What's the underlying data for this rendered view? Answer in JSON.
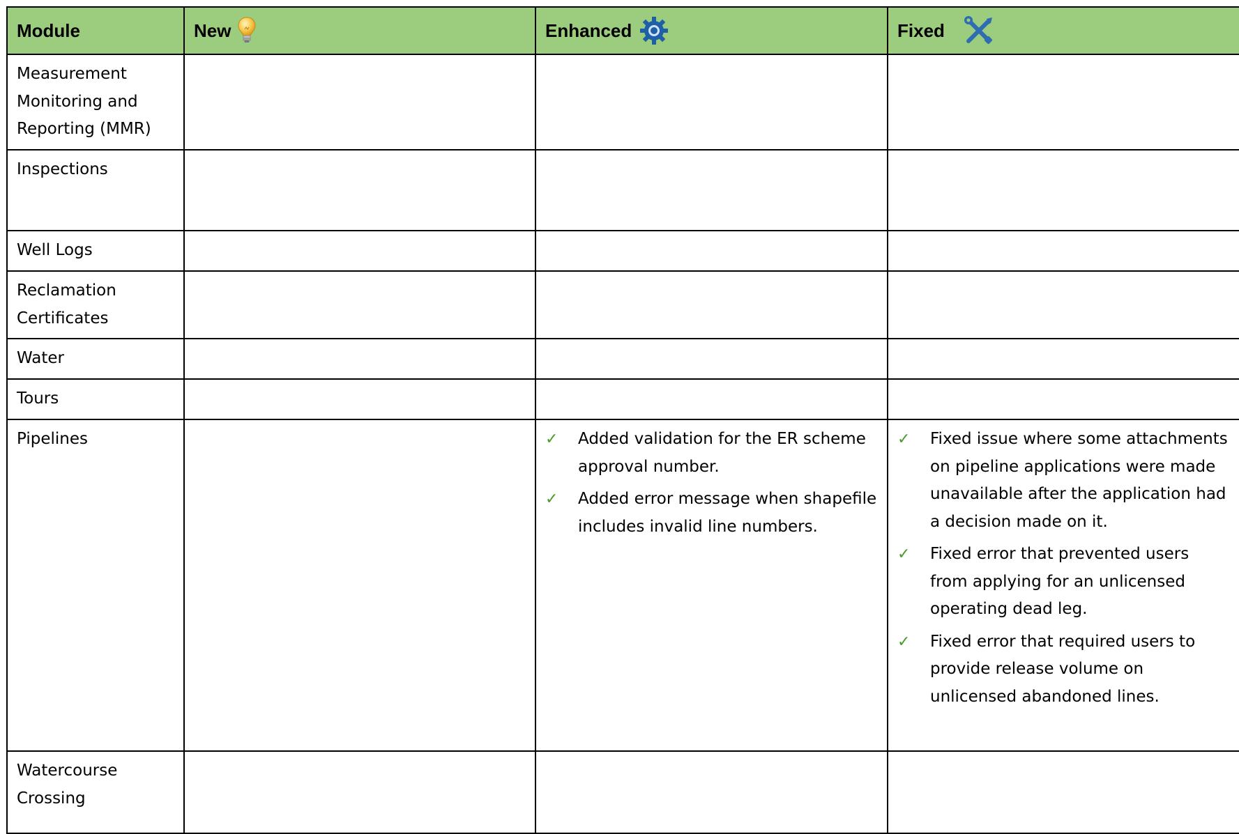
{
  "header": {
    "module": "Module",
    "new": "New",
    "enhanced": "Enhanced",
    "fixed": "Fixed",
    "icons": {
      "new": "lightbulb-icon",
      "enhanced": "gear-icon",
      "fixed": "tools-icon"
    }
  },
  "colors": {
    "header_bg": "#9ccc7d",
    "check": "#4a9a2e",
    "gear": "#1f5fa8",
    "tools": "#2f6db3",
    "bulb": "#f6c84a"
  },
  "rows": [
    {
      "module": "Measurement Monitoring and Reporting (MMR)",
      "new": [],
      "enhanced": [],
      "fixed": []
    },
    {
      "module": "Inspections",
      "new": [],
      "enhanced": [],
      "fixed": []
    },
    {
      "module": "Well Logs",
      "new": [],
      "enhanced": [],
      "fixed": []
    },
    {
      "module": "Reclamation Certificates",
      "new": [],
      "enhanced": [],
      "fixed": []
    },
    {
      "module": "Water",
      "new": [],
      "enhanced": [],
      "fixed": []
    },
    {
      "module": "Tours",
      "new": [],
      "enhanced": [],
      "fixed": []
    },
    {
      "module": "Pipelines",
      "new": [],
      "enhanced": [
        "Added validation for the ER scheme approval number.",
        "Added error message when shapefile includes invalid line numbers."
      ],
      "fixed": [
        "Fixed issue where some attachments on pipeline applications were made unavailable after the application had a decision made on it.",
        "Fixed error that prevented users from applying for an unlicensed operating dead leg.",
        "Fixed error that required users to provide release volume on unlicensed abandoned lines."
      ]
    },
    {
      "module": "Watercourse Crossing",
      "new": [],
      "enhanced": [],
      "fixed": []
    }
  ],
  "check_glyph": "✓"
}
